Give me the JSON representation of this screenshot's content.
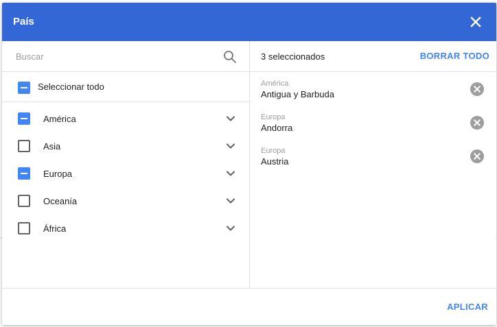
{
  "dialog": {
    "title": "País",
    "close_icon": "close-icon"
  },
  "search": {
    "placeholder": "Buscar",
    "value": "",
    "icon": "search-icon"
  },
  "select_all": {
    "label": "Seleccionar todo",
    "state": "partial"
  },
  "regions": [
    {
      "label": "América",
      "state": "partial"
    },
    {
      "label": "Asia",
      "state": "empty"
    },
    {
      "label": "Europa",
      "state": "partial"
    },
    {
      "label": "Oceanía",
      "state": "empty"
    },
    {
      "label": "África",
      "state": "empty"
    }
  ],
  "summary": {
    "count_label": "3 seleccionados",
    "clear_label": "BORRAR TODO"
  },
  "selected": [
    {
      "region": "América",
      "country": "Antigua y Barbuda"
    },
    {
      "region": "Europa",
      "country": "Andorra"
    },
    {
      "region": "Europa",
      "country": "Austria"
    }
  ],
  "footer": {
    "apply_label": "APLICAR"
  },
  "colors": {
    "header_bg": "#3367d6",
    "accent": "#4285f4",
    "checkbox_border": "#5f6368",
    "remove_icon": "#9e9e9e"
  }
}
